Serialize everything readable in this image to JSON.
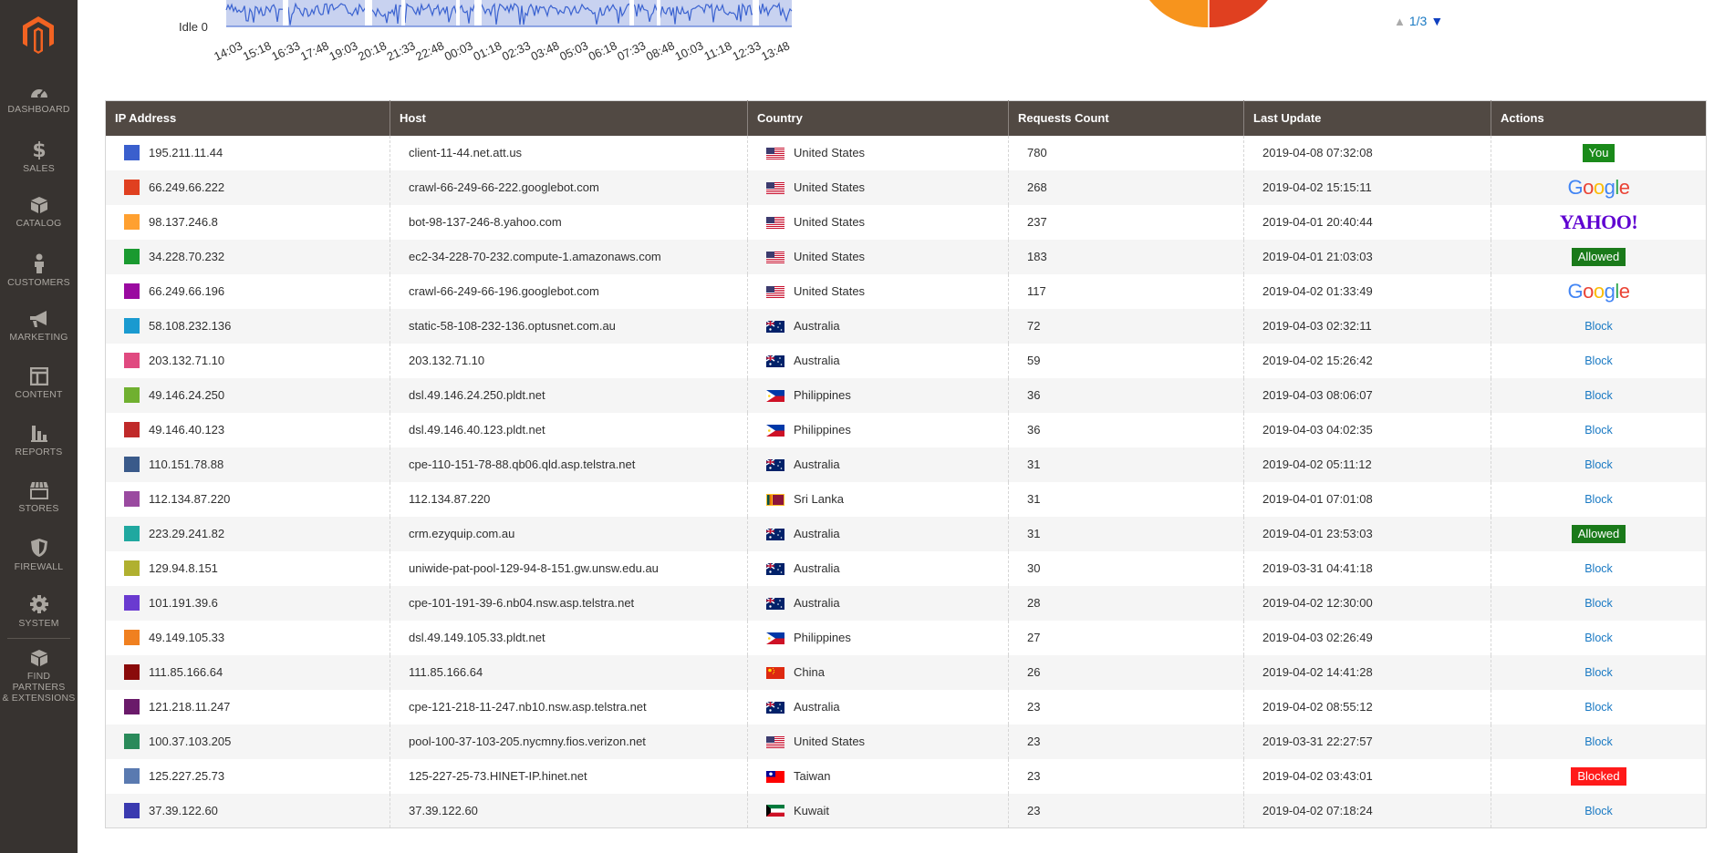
{
  "sidebar": {
    "items": [
      {
        "label": "DASHBOARD",
        "icon": "dashboard-icon"
      },
      {
        "label": "SALES",
        "icon": "dollar-icon"
      },
      {
        "label": "CATALOG",
        "icon": "box-icon"
      },
      {
        "label": "CUSTOMERS",
        "icon": "person-icon"
      },
      {
        "label": "MARKETING",
        "icon": "megaphone-icon"
      },
      {
        "label": "CONTENT",
        "icon": "layout-icon"
      },
      {
        "label": "REPORTS",
        "icon": "bar-chart-icon"
      },
      {
        "label": "STORES",
        "icon": "storefront-icon"
      },
      {
        "label": "FIREWALL",
        "icon": "shield-icon"
      },
      {
        "label": "SYSTEM",
        "icon": "gear-icon"
      }
    ],
    "partners_line1": "FIND PARTNERS",
    "partners_line2": "& EXTENSIONS"
  },
  "chart": {
    "label": "Idle 0",
    "x_ticks": [
      "14:03",
      "15:18",
      "16:33",
      "17:48",
      "19:03",
      "20:18",
      "21:33",
      "22:48",
      "00:03",
      "01:18",
      "02:33",
      "03:48",
      "05:03",
      "06:18",
      "07:33",
      "08:48",
      "10:03",
      "11:18",
      "12:33",
      "13:48"
    ]
  },
  "pager": {
    "text": "1/3"
  },
  "table": {
    "headers": {
      "ip": "IP Address",
      "host": "Host",
      "country": "Country",
      "count": "Requests Count",
      "update": "Last Update",
      "actions": "Actions"
    },
    "rows": [
      {
        "color": "#3a5fcd",
        "ip": "195.211.11.44",
        "host": "client-11-44.net.att.us",
        "country": "United States",
        "flag": "us",
        "count": "780",
        "update": "2019-04-08 07:32:08",
        "action": "You"
      },
      {
        "color": "#e04020",
        "ip": "66.249.66.222",
        "host": "crawl-66-249-66-222.googlebot.com",
        "country": "United States",
        "flag": "us",
        "count": "268",
        "update": "2019-04-02 15:15:11",
        "action": "Google"
      },
      {
        "color": "#ffa030",
        "ip": "98.137.246.8",
        "host": "bot-98-137-246-8.yahoo.com",
        "country": "United States",
        "flag": "us",
        "count": "237",
        "update": "2019-04-01 20:40:44",
        "action": "YAHOO!"
      },
      {
        "color": "#1a9a30",
        "ip": "34.228.70.232",
        "host": "ec2-34-228-70-232.compute-1.amazonaws.com",
        "country": "United States",
        "flag": "us",
        "count": "183",
        "update": "2019-04-01 21:03:03",
        "action": "Allowed"
      },
      {
        "color": "#9a0aa0",
        "ip": "66.249.66.196",
        "host": "crawl-66-249-66-196.googlebot.com",
        "country": "United States",
        "flag": "us",
        "count": "117",
        "update": "2019-04-02 01:33:49",
        "action": "Google"
      },
      {
        "color": "#1a9ad0",
        "ip": "58.108.232.136",
        "host": "static-58-108-232-136.optusnet.com.au",
        "country": "Australia",
        "flag": "au",
        "count": "72",
        "update": "2019-04-03 02:32:11",
        "action": "Block"
      },
      {
        "color": "#e04a80",
        "ip": "203.132.71.10",
        "host": "203.132.71.10",
        "country": "Australia",
        "flag": "au",
        "count": "59",
        "update": "2019-04-02 15:26:42",
        "action": "Block"
      },
      {
        "color": "#70b030",
        "ip": "49.146.24.250",
        "host": "dsl.49.146.24.250.pldt.net",
        "country": "Philippines",
        "flag": "ph",
        "count": "36",
        "update": "2019-04-03 08:06:07",
        "action": "Block"
      },
      {
        "color": "#c02a2a",
        "ip": "49.146.40.123",
        "host": "dsl.49.146.40.123.pldt.net",
        "country": "Philippines",
        "flag": "ph",
        "count": "36",
        "update": "2019-04-03 04:02:35",
        "action": "Block"
      },
      {
        "color": "#3a5a8a",
        "ip": "110.151.78.88",
        "host": "cpe-110-151-78-88.qb06.qld.asp.telstra.net",
        "country": "Australia",
        "flag": "au",
        "count": "31",
        "update": "2019-04-02 05:11:12",
        "action": "Block"
      },
      {
        "color": "#9a4aa0",
        "ip": "112.134.87.220",
        "host": "112.134.87.220",
        "country": "Sri Lanka",
        "flag": "lk",
        "count": "31",
        "update": "2019-04-01 07:01:08",
        "action": "Block"
      },
      {
        "color": "#20a8a0",
        "ip": "223.29.241.82",
        "host": "crm.ezyquip.com.au",
        "country": "Australia",
        "flag": "au",
        "count": "31",
        "update": "2019-04-01 23:53:03",
        "action": "Allowed"
      },
      {
        "color": "#b0b030",
        "ip": "129.94.8.151",
        "host": "uniwide-pat-pool-129-94-8-151.gw.unsw.edu.au",
        "country": "Australia",
        "flag": "au",
        "count": "30",
        "update": "2019-03-31 04:41:18",
        "action": "Block"
      },
      {
        "color": "#6a3ad0",
        "ip": "101.191.39.6",
        "host": "cpe-101-191-39-6.nb04.nsw.asp.telstra.net",
        "country": "Australia",
        "flag": "au",
        "count": "28",
        "update": "2019-04-02 12:30:00",
        "action": "Block"
      },
      {
        "color": "#f08020",
        "ip": "49.149.105.33",
        "host": "dsl.49.149.105.33.pldt.net",
        "country": "Philippines",
        "flag": "ph",
        "count": "27",
        "update": "2019-04-03 02:26:49",
        "action": "Block"
      },
      {
        "color": "#8a0a0a",
        "ip": "111.85.166.64",
        "host": "111.85.166.64",
        "country": "China",
        "flag": "cn",
        "count": "26",
        "update": "2019-04-02 14:41:28",
        "action": "Block"
      },
      {
        "color": "#6a1a6a",
        "ip": "121.218.11.247",
        "host": "cpe-121-218-11-247.nb10.nsw.asp.telstra.net",
        "country": "Australia",
        "flag": "au",
        "count": "23",
        "update": "2019-04-02 08:55:12",
        "action": "Block"
      },
      {
        "color": "#2a8a5a",
        "ip": "100.37.103.205",
        "host": "pool-100-37-103-205.nycmny.fios.verizon.net",
        "country": "United States",
        "flag": "us",
        "count": "23",
        "update": "2019-03-31 22:27:57",
        "action": "Block"
      },
      {
        "color": "#5a7ab0",
        "ip": "125.227.25.73",
        "host": "125-227-25-73.HINET-IP.hinet.net",
        "country": "Taiwan",
        "flag": "tw",
        "count": "23",
        "update": "2019-04-02 03:43:01",
        "action": "Blocked"
      },
      {
        "color": "#3a3ab0",
        "ip": "37.39.122.60",
        "host": "37.39.122.60",
        "country": "Kuwait",
        "flag": "kw",
        "count": "23",
        "update": "2019-04-02 07:18:24",
        "action": "Block"
      }
    ]
  }
}
